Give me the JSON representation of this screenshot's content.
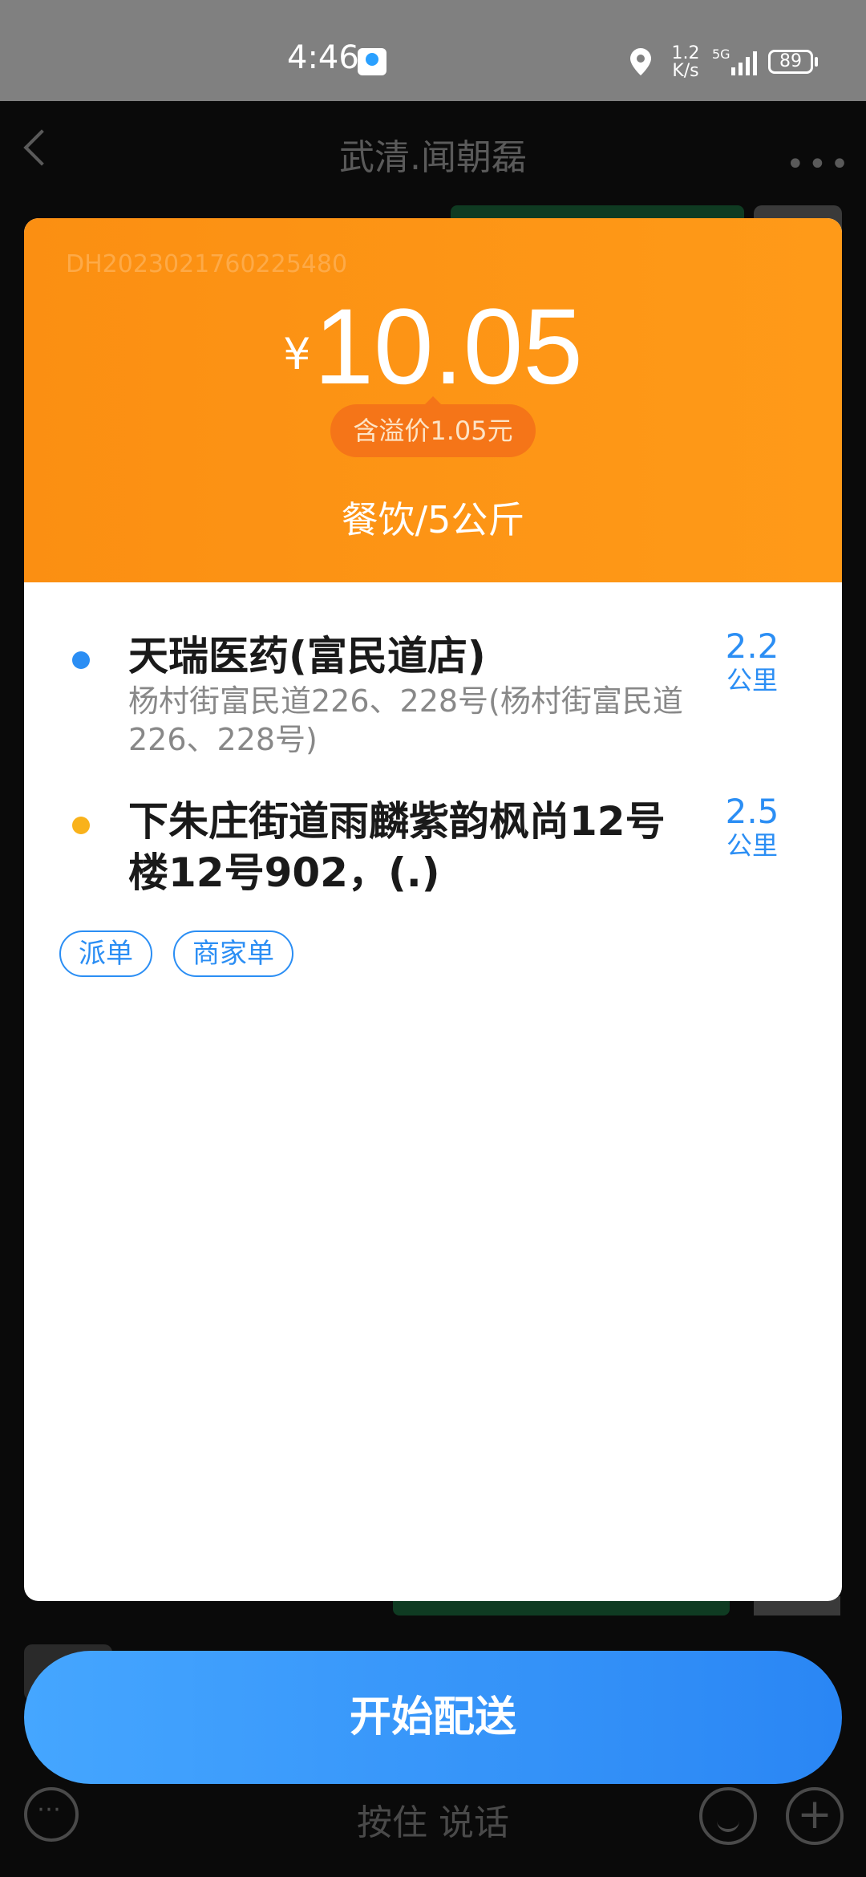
{
  "status_bar": {
    "time": "4:46",
    "net_speed_value": "1.2",
    "net_speed_unit": "K/s",
    "network": "5G",
    "battery": "89"
  },
  "chat": {
    "title": "武清.闻朝磊",
    "voice_hint": "按住 说话"
  },
  "order": {
    "order_no": "DH2023021760225480",
    "currency_symbol": "¥",
    "price": "10.05",
    "premium": "含溢价1.05元",
    "category": "餐饮/5公斤",
    "pickup": {
      "name": "天瑞医药(富民道店)",
      "address": "杨村街富民道226、228号(杨村街富民道226、228号)",
      "distance": "2.2",
      "unit": "公里",
      "color": "#2b8ef4"
    },
    "dropoff": {
      "name": "下朱庄街道雨麟紫韵枫尚12号楼12号902，(.)",
      "distance": "2.5",
      "unit": "公里",
      "color": "#f9b21b"
    },
    "tags": [
      "派单",
      "商家单"
    ],
    "start_button": "开始配送"
  },
  "colors": {
    "header_orange": "#ff9a18",
    "accent_blue": "#2b8ef4"
  }
}
